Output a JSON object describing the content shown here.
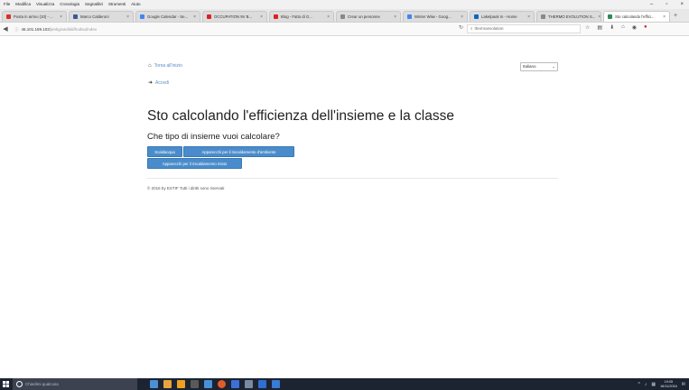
{
  "menubar": {
    "items": [
      "File",
      "Modifica",
      "Visualizza",
      "Cronologia",
      "Segnalibri",
      "Strumenti",
      "Aiuto"
    ],
    "minimize": "–",
    "maximize": "▫",
    "close": "×"
  },
  "tabs": [
    {
      "label": "Posta in arrivo (10) - ...",
      "color": "#d93025"
    },
    {
      "label": "Marco Calderoni",
      "color": "#3b5998"
    },
    {
      "label": "Google Calendar - Se...",
      "color": "#4285f4"
    },
    {
      "label": "OCCUPATION 9V B...",
      "color": "#e02020"
    },
    {
      "label": "Blog - Fatto di G...",
      "color": "#e02020"
    },
    {
      "label": "Crear un personne",
      "color": "#888888"
    },
    {
      "label": "Winter Wiiw - Goog...",
      "color": "#4285f4"
    },
    {
      "label": "Lakelpaok In - Home",
      "color": "#0a66c2"
    },
    {
      "label": "THERMO EVOLUTION S...",
      "color": "#888888"
    },
    {
      "label": "Sto calcolando l'effici...",
      "color": "#2e8b57"
    }
  ],
  "navbar": {
    "url_host": "46.101.159.103",
    "url_path": "/jenkgrandsld/hodsu/index",
    "search_text": "thermoevolution",
    "back": "◀",
    "reload": "↻",
    "toolbar_icons": [
      "☆",
      "▤",
      "⬇",
      "⌂",
      "◉",
      "●"
    ]
  },
  "page": {
    "home_link": "Torna all'inizio",
    "login_link": "Accedi",
    "language": "Italiano",
    "title": "Sto calcolando l'efficienza dell'insieme e la classe",
    "question": "Che tipo di insieme vuoi calcolare?",
    "buttons": {
      "scalda": "Scaldacqua",
      "ambiente": "Apparecchi per il riscaldamento d'ambiente",
      "misto": "Apparecchi per il riscaldamento misto"
    },
    "footer": "© 2016 by ESTIF Tutti i diritti sono riservati"
  },
  "taskbar": {
    "search_placeholder": "Chiedimi qualcosa",
    "app_colors": [
      "#4a90d9",
      "#e8a33d",
      "#f0a020",
      "#5a5a5a",
      "#4a90d9",
      "#e55a2b",
      "#3d6fd9",
      "#7a8aa0",
      "#2f6fd0",
      "#3a7bd5"
    ],
    "clock_time": "19:05",
    "clock_date": "16/11/2016",
    "tray_icons": [
      "^",
      "♪",
      "▦",
      "✉"
    ]
  }
}
